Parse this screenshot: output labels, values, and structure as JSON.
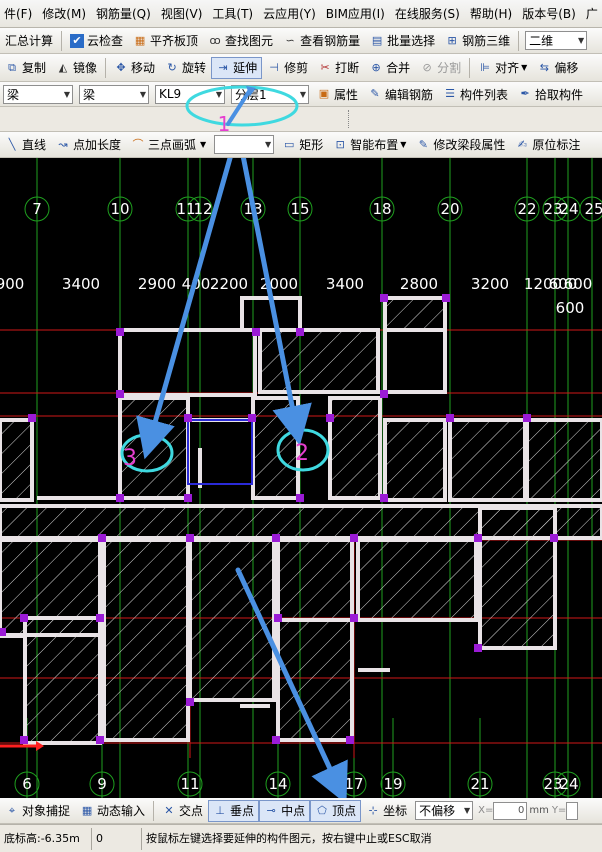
{
  "menubar": {
    "items": [
      {
        "label": "件(F)"
      },
      {
        "label": "修改(M)"
      },
      {
        "label": "钢筋量(Q)"
      },
      {
        "label": "视图(V)"
      },
      {
        "label": "工具(T)"
      },
      {
        "label": "云应用(Y)"
      },
      {
        "label": "BIM应用(I)"
      },
      {
        "label": "在线服务(S)"
      },
      {
        "label": "帮助(H)"
      },
      {
        "label": "版本号(B)"
      },
      {
        "label": "广"
      }
    ]
  },
  "toolbar1": {
    "summary_calc": "汇总计算",
    "cloud_check": "云检查",
    "align_slab_top": "平齐板顶",
    "find_element": "查找图元",
    "view_rebar": "查看钢筋量",
    "batch_select": "批量选择",
    "rebar_3d": "钢筋三维",
    "view_mode": "二维"
  },
  "toolbar2": {
    "copy": "复制",
    "mirror": "镜像",
    "move": "移动",
    "rotate": "旋转",
    "extend": "延伸",
    "trim": "修剪",
    "break": "打断",
    "merge": "合并",
    "split": "分割",
    "align": "对齐",
    "offset": "偏移"
  },
  "propbar": {
    "element_type": "梁",
    "element_subtype": "梁",
    "element_name": "KL9",
    "layer": "分层1",
    "properties": "属性",
    "edit_rebar": "编辑钢筋",
    "element_list": "构件列表",
    "pick_element": "拾取构件"
  },
  "drawbar": {
    "line": "直线",
    "point_length": "点加长度",
    "three_point_arc": "三点画弧",
    "rectangle": "矩形",
    "smart_layout": "智能布置",
    "edit_span_props": "修改梁段属性",
    "in_situ_label": "原位标注"
  },
  "canvas": {
    "top_axes": [
      "7",
      "10",
      "11",
      "12",
      "13",
      "15",
      "18",
      "20",
      "22",
      "23",
      "24",
      "25"
    ],
    "bottom_axes": [
      "6",
      "9",
      "11",
      "14",
      "17",
      "19",
      "21",
      "23",
      "24"
    ],
    "dimensions": [
      "900",
      "3400",
      "2900",
      "400",
      "2200",
      "2000",
      "3400",
      "2800",
      "3200",
      "1200",
      "600",
      "600",
      "600"
    ],
    "annotations": [
      "1",
      "2",
      "3"
    ],
    "colors": {
      "background": "#000000",
      "axis_line": "#1f9f1f",
      "red_line": "#d01818",
      "beam_fill": "#e9e3e6",
      "column": "#9b1bd6",
      "hatch": "#d8d8d8",
      "annotation": "#e63fd0",
      "highlight": "#3fd9e0",
      "arrow": "#4a90e2"
    }
  },
  "snapbar": {
    "object_snap": "对象捕捉",
    "dynamic_input": "动态输入",
    "intersection": "交点",
    "perpendicular": "垂点",
    "midpoint": "中点",
    "vertex": "顶点",
    "coordinate": "坐标",
    "offset_mode": "不偏移",
    "x_label": "X=",
    "x_value": "0",
    "unit": "mm",
    "y_label": "Y="
  },
  "statusbar": {
    "floor_elevation": "底标高:-6.35m",
    "count": "0",
    "hint": "按鼠标左键选择要延伸的构件图元，按右键中止或ESC取消"
  }
}
